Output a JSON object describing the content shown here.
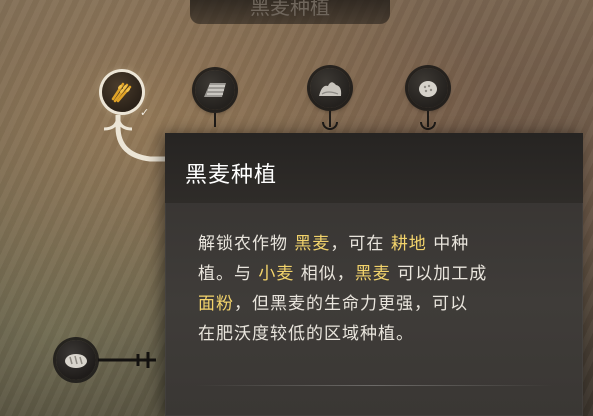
{
  "header": {
    "title": "黑麦种植"
  },
  "tech_nodes": [
    {
      "icon": "rye-icon",
      "state": "selected"
    },
    {
      "icon": "tilled-field-icon",
      "state": "locked"
    },
    {
      "icon": "grain-pile-icon",
      "state": "locked"
    },
    {
      "icon": "seed-sack-icon",
      "state": "locked"
    }
  ],
  "bottom_node": {
    "icon": "bread-icon"
  },
  "tooltip": {
    "title": "黑麦种植",
    "body": {
      "l1a": "解锁农作物 ",
      "l1b": "黑麦",
      "l1c": "，可在 ",
      "l1d": "耕地",
      "l1e": " 中种",
      "l2a": "植。与 ",
      "l2b": "小麦",
      "l2c": " 相似，",
      "l2d": "黑麦",
      "l2e": " 可以加工成",
      "l3a": "面粉",
      "l3b": "，但黑麦的生命力更强，可以",
      "l4a": "在肥沃度较低的区域种植。"
    },
    "highlight_color": "#f2d36b"
  }
}
